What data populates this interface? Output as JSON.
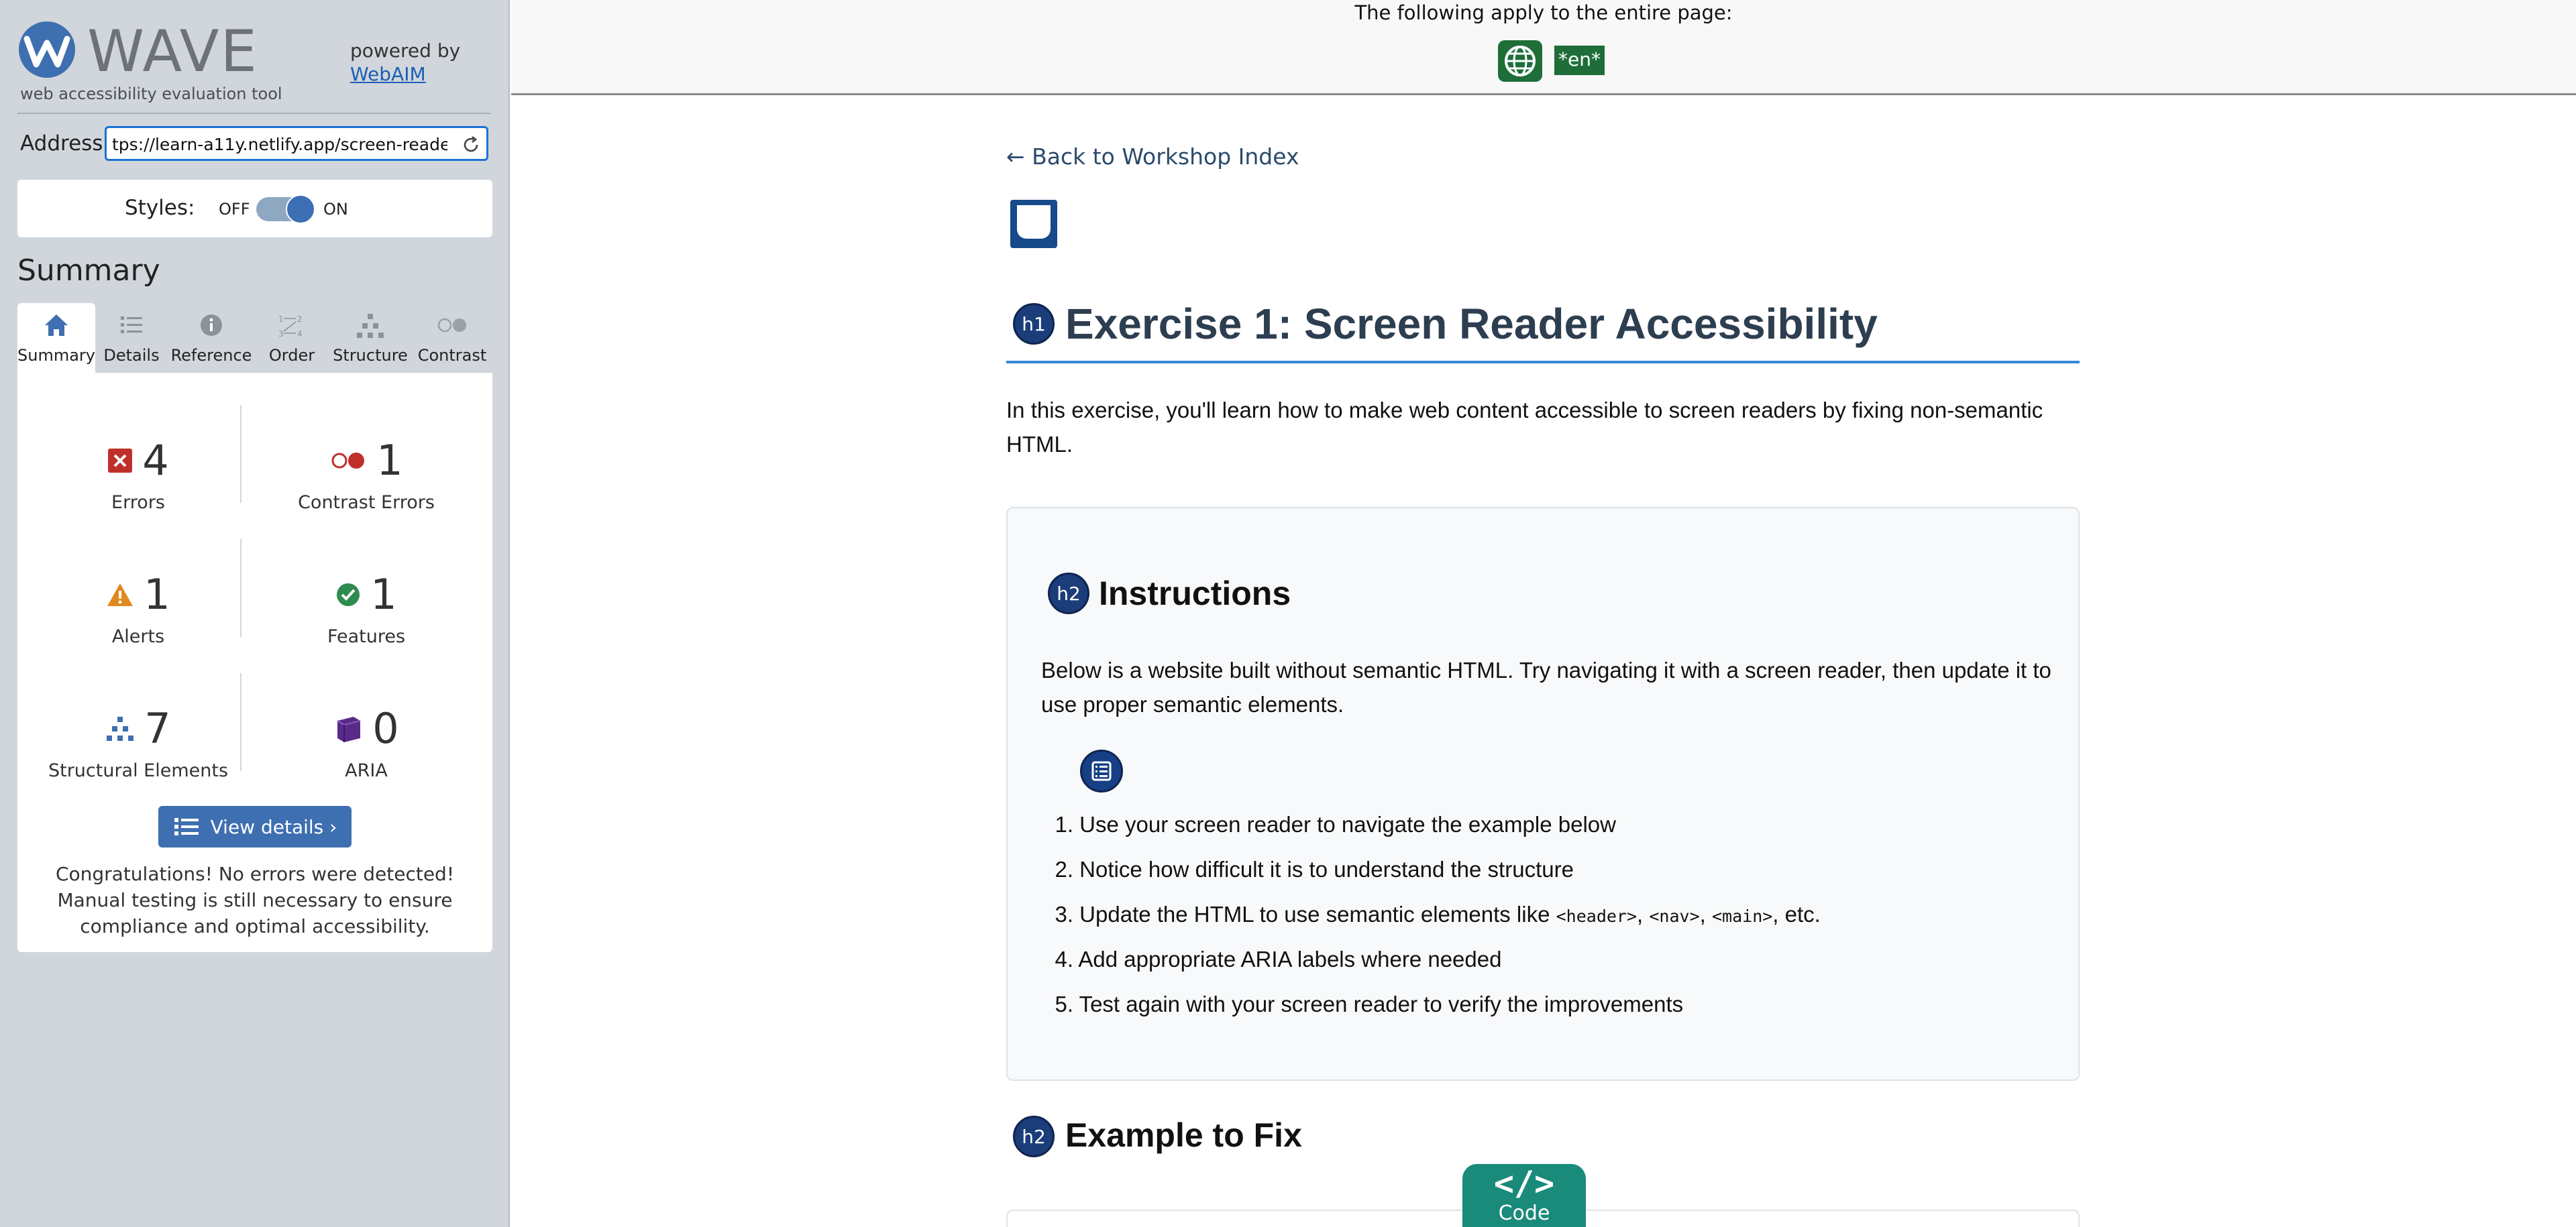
{
  "wave": {
    "brand": "WAVE",
    "tagline": "web accessibility evaluation tool",
    "powered_by": "powered by",
    "powered_link": "WebAIM",
    "address_label": "Address:",
    "address_value": "tps://learn-a11y.netlify.app/screen-reader",
    "styles_label": "Styles:",
    "styles_off": "OFF",
    "styles_on": "ON",
    "styles_enabled": true,
    "summary_title": "Summary",
    "tabs": [
      {
        "label": "Summary",
        "icon": "home-icon",
        "active": true
      },
      {
        "label": "Details",
        "icon": "list-icon"
      },
      {
        "label": "Reference",
        "icon": "info-icon"
      },
      {
        "label": "Order",
        "icon": "order-icon"
      },
      {
        "label": "Structure",
        "icon": "structure-icon"
      },
      {
        "label": "Contrast",
        "icon": "contrast-icon"
      }
    ],
    "stats": {
      "errors": {
        "count": "4",
        "label": "Errors"
      },
      "contrast_errors": {
        "count": "1",
        "label": "Contrast Errors"
      },
      "alerts": {
        "count": "1",
        "label": "Alerts"
      },
      "features": {
        "count": "1",
        "label": "Features"
      },
      "structural": {
        "count": "7",
        "label": "Structural Elements"
      },
      "aria": {
        "count": "0",
        "label": "ARIA"
      }
    },
    "view_details": "View details ›",
    "congrats": "Congratulations! No errors were detected! Manual testing is still necessary to ensure compliance and optimal accessibility."
  },
  "page": {
    "topbar_text": "The following apply to the entire page:",
    "lang_badge": "*en*",
    "back_link": "← Back to Workshop Index",
    "h1_badge": "h1",
    "h1": "Exercise 1: Screen Reader Accessibility",
    "intro": "In this exercise, you'll learn how to make web content accessible to screen readers by fixing non-semantic HTML.",
    "h2_badge": "h2",
    "instructions_title": "Instructions",
    "instructions_para": "Below is a website built without semantic HTML. Try navigating it with a screen reader, then update it to use proper semantic elements.",
    "steps": [
      {
        "num": "1.",
        "text": "Use your screen reader to navigate the example below"
      },
      {
        "num": "2.",
        "text": "Notice how difficult it is to understand the structure"
      },
      {
        "num": "3.",
        "before": "Update the HTML to use semantic elements like ",
        "code1": "<header>",
        "sep1": ", ",
        "code2": "<nav>",
        "sep2": ", ",
        "code3": "<main>",
        "after": ", etc."
      },
      {
        "num": "4.",
        "text": "Add appropriate ARIA labels where needed"
      },
      {
        "num": "5.",
        "text": "Test again with your screen reader to verify the improvements"
      }
    ],
    "example_title": "Example to Fix",
    "code_tab_glyph": "</>",
    "code_tab_label": "Code"
  },
  "colors": {
    "wave_blue": "#3e6fb0",
    "error_red": "#c0302b",
    "alert_orange": "#e08a1e",
    "feature_green": "#2e8b4f",
    "aria_purple": "#5a2a8a",
    "heading_badge": "#1b3d7a",
    "h1_rule": "#3a8ad6",
    "code_tab": "#1a8a7a"
  }
}
